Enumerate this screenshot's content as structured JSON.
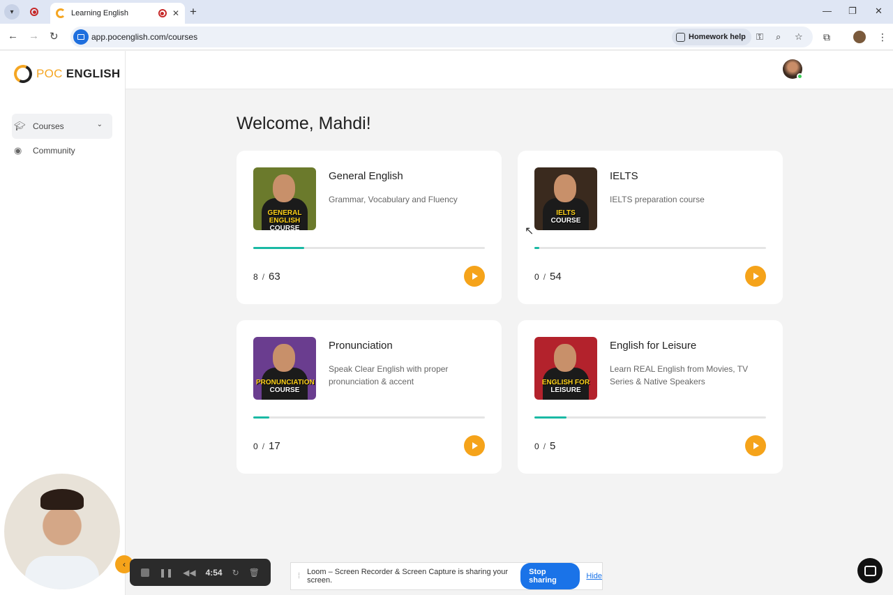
{
  "browser": {
    "tab_title": "Learning English",
    "url": "app.pocenglish.com/courses",
    "homework_help": "Homework help"
  },
  "sidebar": {
    "logo_prefix": "POC ",
    "logo_main": "ENGLISH",
    "items": [
      {
        "label": "Courses",
        "icon": "graduation-cap-icon"
      },
      {
        "label": "Community",
        "icon": "discord-icon"
      }
    ]
  },
  "main": {
    "welcome": "Welcome, Mahdi!",
    "courses": [
      {
        "title": "General English",
        "desc": "Grammar, Vocabulary and Fluency",
        "done": "8",
        "total": "63",
        "progress": 0.22,
        "thumb_line1": "GENERAL ENGLISH",
        "thumb_line2": "COURSE",
        "thumb_color": "#6b7a2c"
      },
      {
        "title": "IELTS",
        "desc": "IELTS preparation course",
        "done": "0",
        "total": "54",
        "progress": 0.02,
        "thumb_line1": "IELTS",
        "thumb_line2": "COURSE",
        "thumb_color": "#3a2a1e"
      },
      {
        "title": "Pronunciation",
        "desc": "Speak Clear English with proper pronunciation & accent",
        "done": "0",
        "total": "17",
        "progress": 0.07,
        "thumb_line1": "PRONUNCIATION",
        "thumb_line2": "COURSE",
        "thumb_color": "#6a3d8f"
      },
      {
        "title": "English for Leisure",
        "desc": "Learn REAL English from Movies, TV Series & Native Speakers",
        "done": "0",
        "total": "5",
        "progress": 0.14,
        "thumb_line1": "ENGLISH FOR",
        "thumb_line2": "LEISURE",
        "thumb_color": "#b3222c"
      }
    ]
  },
  "loom": {
    "time": "4:54",
    "message": "Loom – Screen Recorder & Screen Capture is sharing your screen.",
    "stop": "Stop sharing",
    "hide": "Hide"
  },
  "colors": {
    "accent": "#f5a31a",
    "progress": "#1ab9a4",
    "brand_blue": "#1a73e8"
  }
}
